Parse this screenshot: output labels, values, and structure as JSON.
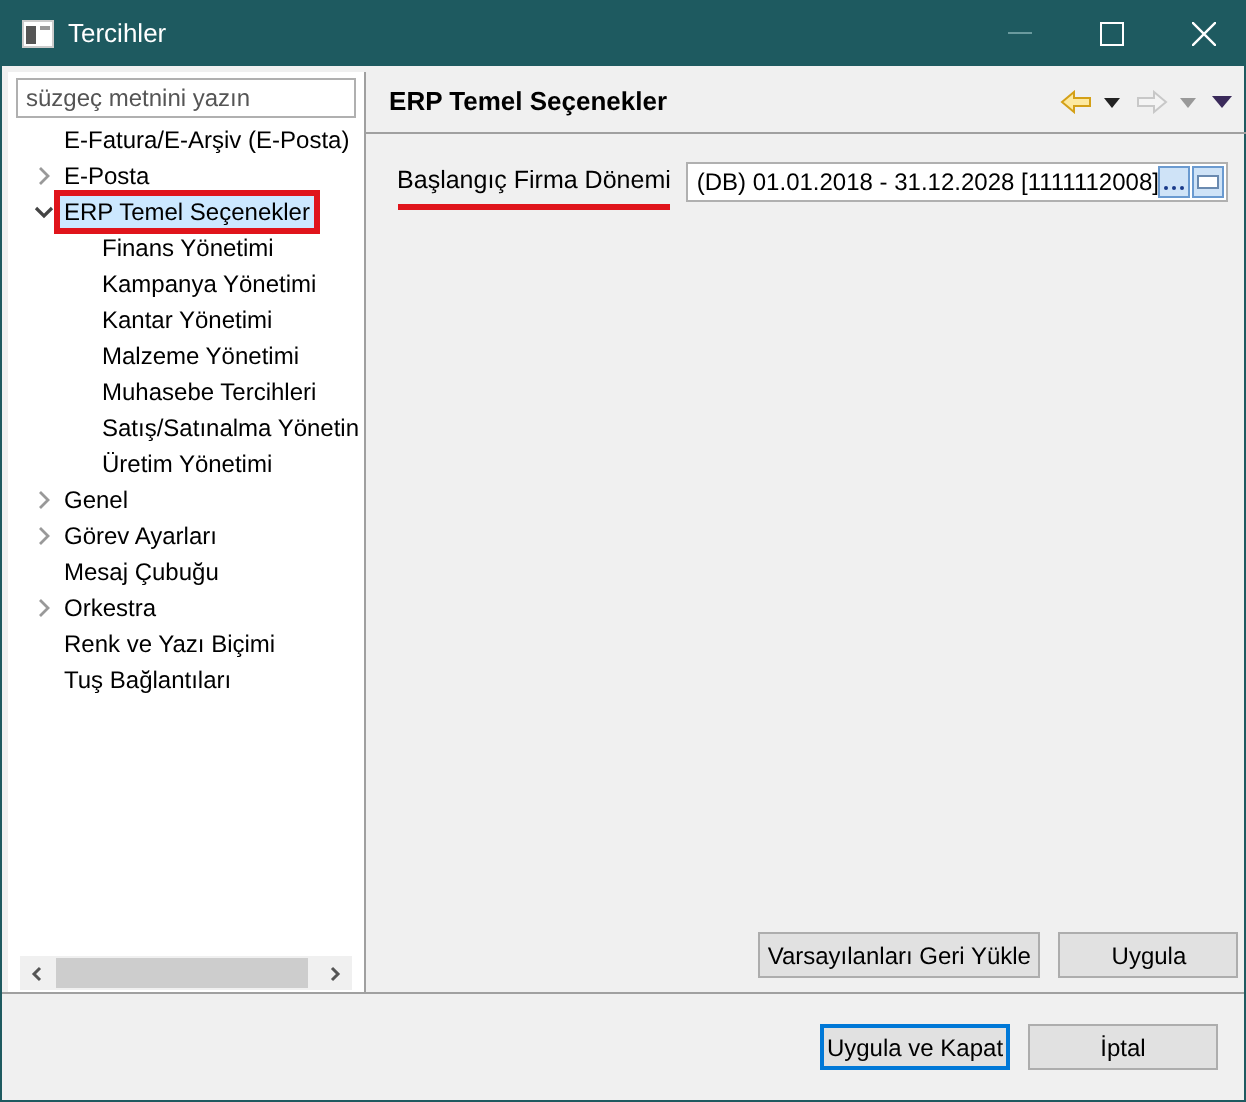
{
  "window": {
    "title": "Tercihler"
  },
  "filter": {
    "placeholder": "süzgeç metnini yazın"
  },
  "tree": [
    {
      "label": "E-Fatura/E-Arşiv (E-Posta)",
      "selected": false,
      "expandable": false,
      "expanded": false
    },
    {
      "label": "E-Posta",
      "selected": false,
      "expandable": true,
      "expanded": false
    },
    {
      "label": "ERP Temel Seçenekler",
      "selected": true,
      "expandable": true,
      "expanded": true,
      "children": [
        {
          "label": "Finans Yönetimi",
          "selected": false
        },
        {
          "label": "Kampanya Yönetimi",
          "selected": false
        },
        {
          "label": "Kantar Yönetimi",
          "selected": false
        },
        {
          "label": "Malzeme Yönetimi",
          "selected": false
        },
        {
          "label": "Muhasebe Tercihleri",
          "selected": false
        },
        {
          "label": "Satış/Satınalma Yönetin",
          "selected": false
        },
        {
          "label": "Üretim Yönetimi",
          "selected": false
        }
      ]
    },
    {
      "label": "Genel",
      "selected": false,
      "expandable": true,
      "expanded": false
    },
    {
      "label": "Görev Ayarları",
      "selected": false,
      "expandable": true,
      "expanded": false
    },
    {
      "label": "Mesaj Çubuğu",
      "selected": false,
      "expandable": false,
      "expanded": false
    },
    {
      "label": "Orkestra",
      "selected": false,
      "expandable": true,
      "expanded": false
    },
    {
      "label": "Renk ve Yazı Biçimi",
      "selected": false,
      "expandable": false,
      "expanded": false
    },
    {
      "label": "Tuş Bağlantıları",
      "selected": false,
      "expandable": false,
      "expanded": false
    }
  ],
  "page": {
    "title": "ERP Temel Seçenekler",
    "field": {
      "label": "Başlangıç Firma Dönemi",
      "value": "(DB) 01.01.2018 - 31.12.2028 [1111112008]"
    }
  },
  "page_buttons": [
    "Varsayılanları Geri Yükle",
    "Uygula"
  ],
  "dialog_buttons": [
    {
      "label": "Uygula ve Kapat",
      "default": true
    },
    {
      "label": "İptal",
      "default": false
    }
  ]
}
